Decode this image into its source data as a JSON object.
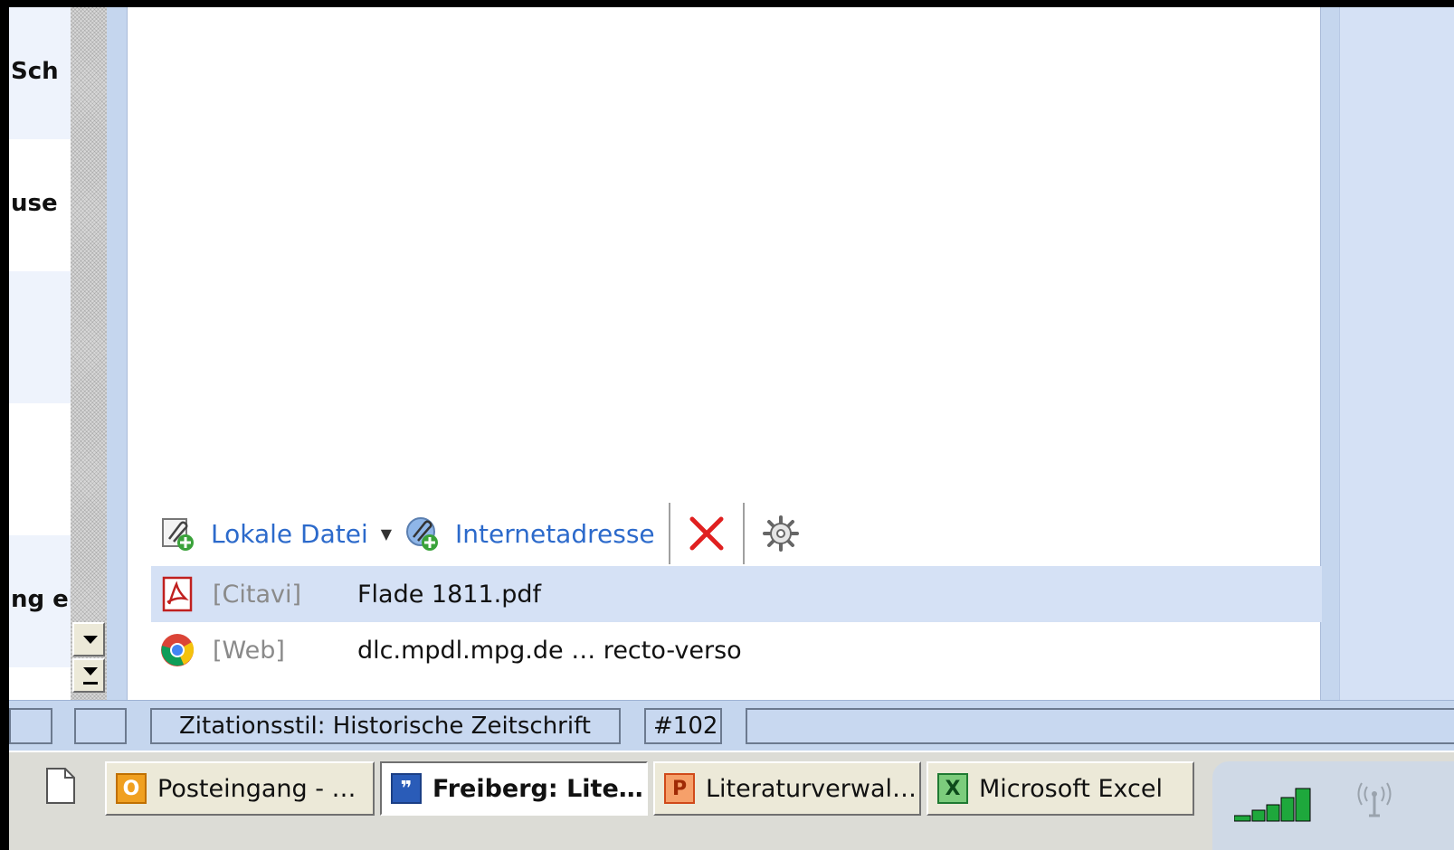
{
  "left_list": {
    "rows": [
      {
        "text": "Sch"
      },
      {
        "text": "use"
      },
      {
        "text": ""
      },
      {
        "text": ""
      },
      {
        "text": "ng ei"
      }
    ]
  },
  "toolbar": {
    "local_file_label": "Lokale Datei",
    "web_address_label": "Internetadresse",
    "delete_icon": "red-x-icon",
    "settings_icon": "gear-icon"
  },
  "attachments": [
    {
      "source": "[Citavi]",
      "name": "Flade 1811.pdf",
      "icon": "pdf-icon",
      "selected": true
    },
    {
      "source": "[Web]",
      "name": "dlc.mpdl.mpg.de … recto-verso",
      "icon": "chrome-icon",
      "selected": false
    }
  ],
  "status": {
    "cell_a": "",
    "cell_b": "",
    "citation_style": "Zitationsstil: Historische Zeitschrift",
    "record_number": "#102",
    "rest": ""
  },
  "taskbar": {
    "tasks": [
      {
        "label": "Posteingang - …",
        "icon": "outlook-icon",
        "active": false
      },
      {
        "label": "Freiberg: Lite…",
        "icon": "citavi-icon",
        "active": true
      },
      {
        "label": "Literaturverwal…",
        "icon": "powerpoint-icon",
        "active": false
      },
      {
        "label": "Microsoft Excel",
        "icon": "excel-icon",
        "active": false
      }
    ]
  },
  "colors": {
    "link_blue": "#2c6acb",
    "selection": "#d5e1f5",
    "delete_red": "#e02020",
    "outlook_orange": "#f0a020",
    "citavi_blue": "#2a5cb8",
    "powerpoint_orange": "#d04a1a",
    "excel_green": "#1f7a32",
    "signal_green": "#1ea83c"
  }
}
